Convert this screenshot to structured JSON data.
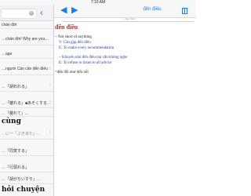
{
  "status": {
    "time": "7:10 AM"
  },
  "sidebar": {
    "items": [
      {
        "type": "text",
        "text": "chán đời",
        "sub": ""
      },
      {
        "type": "text",
        "text": "…chán đời! Why are you…",
        "sub": ""
      },
      {
        "type": "text",
        "text": "…age",
        "sub": ""
      },
      {
        "type": "text",
        "text": "…người Cán cần đến điều",
        "sub": ""
      },
      {
        "type": "text",
        "text": "…「胡石れる」",
        "sub": ""
      },
      {
        "type": "text",
        "text": "…「雑れる」■あそくする…",
        "sub": ""
      },
      {
        "type": "text",
        "text": "…「雑れて」...",
        "sub": ""
      },
      {
        "type": "big",
        "text": "cùng",
        "sub": "…に一「ぶきあた」…"
      },
      {
        "type": "text",
        "text": "…「同意する」",
        "sub": ""
      },
      {
        "type": "text",
        "text": "…「行頭れる」",
        "sub": ""
      },
      {
        "type": "text",
        "text": "…「胡がちいすり」…",
        "sub": ""
      },
      {
        "type": "big",
        "text": "hỏi chuyện",
        "sub": ""
      }
    ]
  },
  "nav": {
    "back_arrow": "◀",
    "forward_arrow": "▶",
    "title": "đến điều",
    "subbar_label": "Viet - Anh"
  },
  "entry": {
    "headword": "đến điều",
    "lines": [
      {
        "text": "~ Not short of anything",
        "style": "dark"
      },
      {
        "text": "V: Cần gặp đến điều",
        "style": "blue"
      },
      {
        "text": "E: To make every recommendation",
        "style": "blue"
      },
      {
        "text": "~ Khuyên nhủ đến điều mà vẫn không nghe",
        "style": "blue"
      },
      {
        "text": "E: To refuse to listen to all advice",
        "style": "blue"
      },
      {
        "text": "=đến đổi như đến nổi",
        "style": "dark"
      }
    ]
  },
  "colors": {
    "accent": "#1a7cf5",
    "headword": "#d2281e",
    "example": "#1e3fa8"
  }
}
